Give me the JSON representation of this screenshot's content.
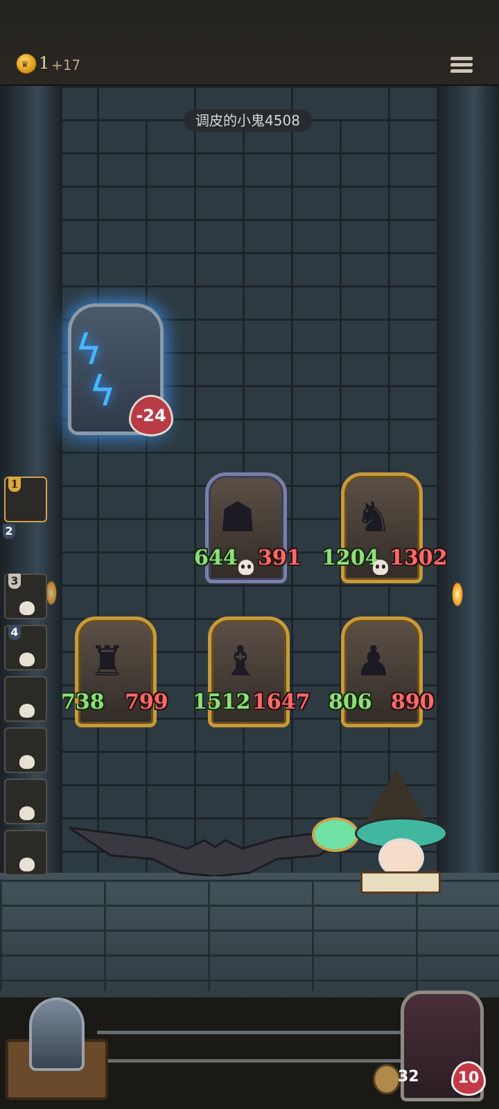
{
  "topbar": {
    "gold": "1",
    "gold_income": "+17",
    "menu_icon": "menu-icon"
  },
  "opponent": {
    "name": "调皮的小鬼4508"
  },
  "enemy_hero": {
    "damage": "-24"
  },
  "board": {
    "row1": [
      {
        "atk": "644",
        "hp": "391"
      },
      {
        "atk": "1204",
        "hp": "1302"
      }
    ],
    "row2": [
      {
        "atk": "738",
        "hp": "799"
      },
      {
        "atk": "1512",
        "hp": "1647"
      },
      {
        "atk": "806",
        "hp": "890"
      }
    ]
  },
  "queue": {
    "numbers": [
      "1",
      "2",
      "3",
      "4"
    ]
  },
  "player": {
    "attack": "32",
    "health": "10"
  }
}
